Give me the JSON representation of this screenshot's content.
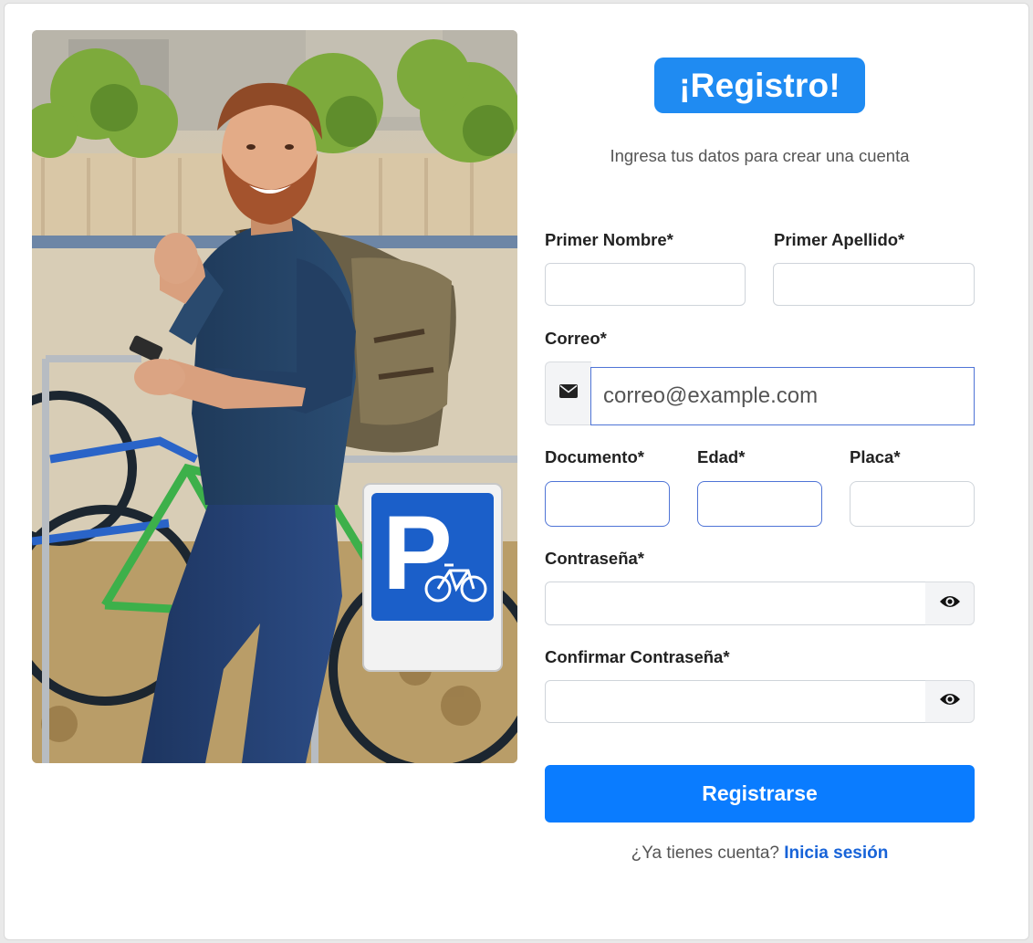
{
  "illustration": {
    "alt": "Hombre sonriente con mochila apoyado en un aparcamiento de bicicletas",
    "sign_letter": "P"
  },
  "header": {
    "title": "¡Registro!",
    "subtitle": "Ingresa tus datos para crear una cuenta"
  },
  "form": {
    "first_name": {
      "label": "Primer Nombre*",
      "value": "",
      "placeholder": ""
    },
    "last_name": {
      "label": "Primer Apellido*",
      "value": "",
      "placeholder": ""
    },
    "email": {
      "label": "Correo*",
      "value": "",
      "placeholder": "correo@example.com",
      "icon": "envelope-icon"
    },
    "document": {
      "label": "Documento*",
      "value": "",
      "placeholder": ""
    },
    "age": {
      "label": "Edad*",
      "value": "",
      "placeholder": ""
    },
    "plate": {
      "label": "Placa*",
      "value": "",
      "placeholder": ""
    },
    "password": {
      "label": "Contraseña*",
      "value": "",
      "placeholder": "",
      "icon": "eye-icon"
    },
    "confirm_password": {
      "label": "Confirmar Contraseña*",
      "value": "",
      "placeholder": "",
      "icon": "eye-icon"
    },
    "submit_label": "Registrarse"
  },
  "footer": {
    "prompt": "¿Ya tienes cuenta?",
    "login_link": "Inicia sesión"
  },
  "colors": {
    "primary": "#0a7cff",
    "title_badge": "#1f8bf2",
    "link": "#1763d8",
    "focus_border": "#4f74d6"
  }
}
